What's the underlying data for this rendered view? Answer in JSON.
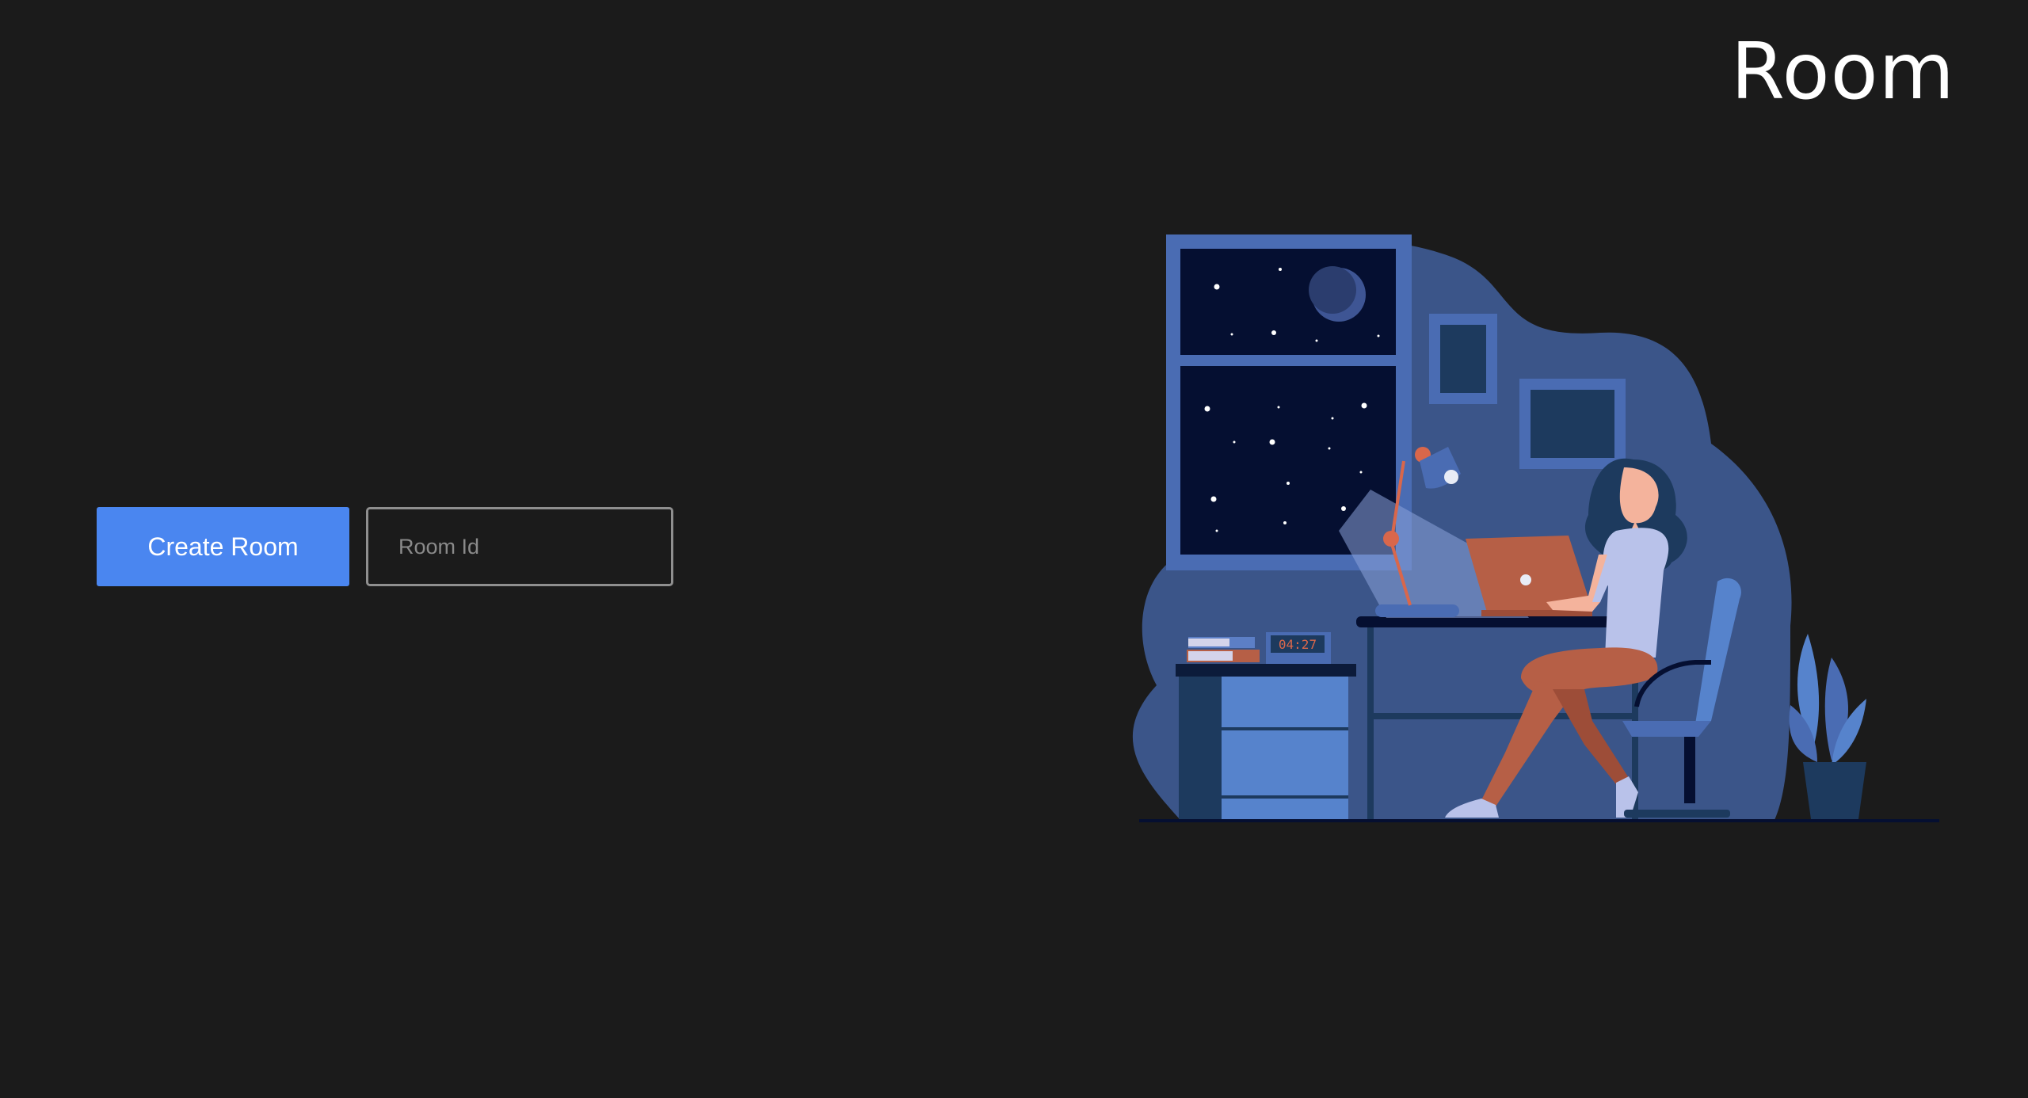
{
  "header": {
    "title": "Room"
  },
  "controls": {
    "create_label": "Create Room",
    "room_id_placeholder": "Room Id",
    "room_id_value": ""
  },
  "illustration": {
    "clock_time": "04:27"
  },
  "colors": {
    "background": "#1b1b1b",
    "accent": "#4a86f0",
    "input_border": "#8f8f8f"
  }
}
